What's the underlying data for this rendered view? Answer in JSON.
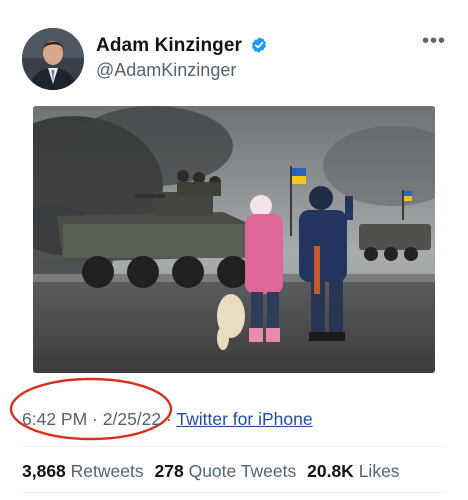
{
  "tweet": {
    "author_name": "Adam Kinzinger",
    "author_handle": "@AdamKinzinger",
    "more_glyph": "•••",
    "time": "6:42 PM",
    "separator": " · ",
    "date": "2/25/22",
    "source": "Twitter for iPhone"
  },
  "stats": {
    "retweets_count": "3,868",
    "retweets_label": "Retweets",
    "quotes_count": "278",
    "quotes_label": "Quote Tweets",
    "likes_count": "20.8K",
    "likes_label": "Likes"
  },
  "colors": {
    "verified_badge": "#1d9bf0",
    "annotation_circle": "#d9301c",
    "link": "#1d4fa0"
  }
}
